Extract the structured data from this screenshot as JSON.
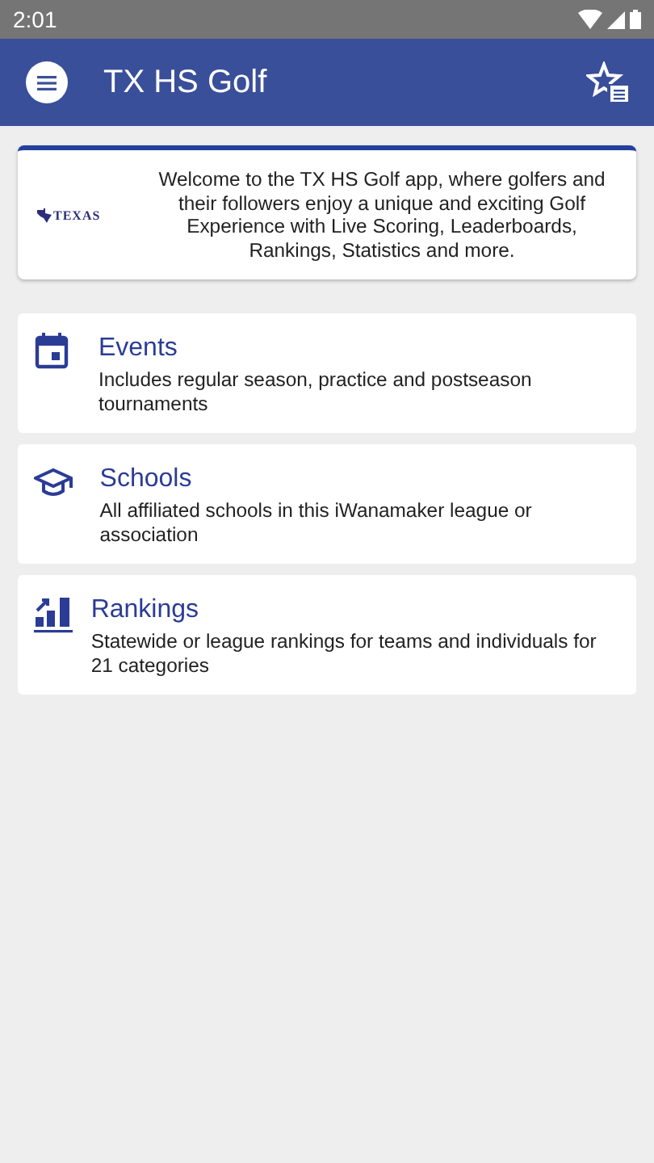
{
  "status_bar": {
    "time": "2:01"
  },
  "app_bar": {
    "title": "TX HS Golf"
  },
  "welcome": {
    "logo_text": "TEXAS",
    "text": "Welcome to the TX HS Golf app, where golfers and their followers enjoy a unique and exciting Golf Experience with Live Scoring, Leaderboards, Rankings, Statistics and more."
  },
  "menu_items": [
    {
      "kind": "calendar",
      "title": "Events",
      "description": "Includes regular season, practice and postseason tournaments"
    },
    {
      "kind": "school",
      "title": "Schools",
      "description": "All affiliated schools in this iWanamaker league or association"
    },
    {
      "kind": "chart",
      "title": "Rankings",
      "description": "Statewide or league rankings for teams and individuals for 21 categories"
    }
  ]
}
